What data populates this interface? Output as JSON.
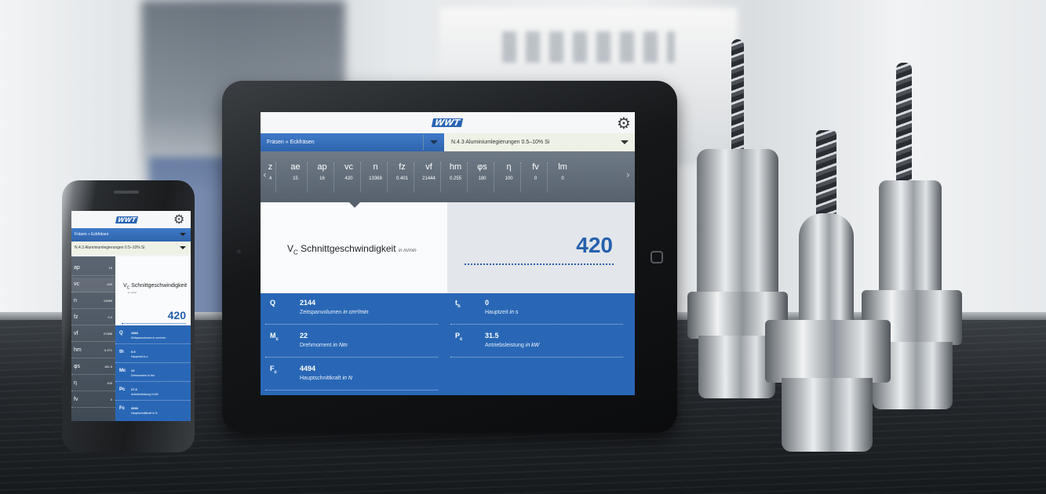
{
  "app": {
    "logo_text": "WWT",
    "settings_icon": "gear-icon",
    "accent_color": "#2967b6"
  },
  "tablet": {
    "selector_operation": "Fräsen » Eckfräsen",
    "selector_material": "N.4.3 Aluminiumlegierungen 0.5–10% Si",
    "parameters": [
      {
        "sym": "ae",
        "val": "15"
      },
      {
        "sym": "ap",
        "val": "16"
      },
      {
        "sym": "vc",
        "val": "420"
      },
      {
        "sym": "n",
        "val": "13369"
      },
      {
        "sym": "fz",
        "val": "0.401"
      },
      {
        "sym": "vf",
        "val": "21444"
      },
      {
        "sym": "hm",
        "val": "0.255"
      },
      {
        "sym": "φs",
        "val": "180"
      },
      {
        "sym": "η",
        "val": "100"
      },
      {
        "sym": "fv",
        "val": "0"
      },
      {
        "sym": "lm",
        "val": "0"
      }
    ],
    "edge_param": {
      "sym": "z",
      "val": "4"
    },
    "selected": {
      "symbol": "V",
      "subscript": "C",
      "label": "Schnittgeschwindigkeit",
      "unit": "in m/min",
      "value": "420"
    },
    "results": [
      {
        "sym": "Q",
        "sub": "",
        "value": "2144",
        "label": "Zeitspanvolumen",
        "unit": "in cm³/min"
      },
      {
        "sym": "t",
        "sub": "h",
        "value": "0",
        "label": "Hauptzeit",
        "unit": "in s"
      },
      {
        "sym": "M",
        "sub": "c",
        "value": "22",
        "label": "Drehmoment",
        "unit": "in Nm"
      },
      {
        "sym": "P",
        "sub": "c",
        "value": "31.5",
        "label": "Antriebsleistung",
        "unit": "in kW"
      },
      {
        "sym": "F",
        "sub": "c",
        "value": "4494",
        "label": "Hauptschnittkraft",
        "unit": "in N"
      }
    ]
  },
  "phone": {
    "selector_operation": "Fräsen » Eckfräsen",
    "selector_material": "N.4.3 Aluminiumlegierungen 0.5–10% Si",
    "side_params": [
      {
        "sym": "ap",
        "val": "16"
      },
      {
        "sym": "vc",
        "val": "420"
      },
      {
        "sym": "n",
        "val": "13369"
      },
      {
        "sym": "fz",
        "val": "0.4"
      },
      {
        "sym": "vf",
        "val": "21386"
      },
      {
        "sym": "hm",
        "val": "0.271"
      },
      {
        "sym": "φs",
        "val": "161.5"
      },
      {
        "sym": "η",
        "val": "100"
      },
      {
        "sym": "fv",
        "val": "0"
      }
    ],
    "selected": {
      "symbol": "V",
      "subscript": "C",
      "label": "Schnittgeschwindigkeit",
      "unit": "in m/min",
      "value": "420"
    },
    "results": [
      {
        "sym": "Q",
        "value": "1863",
        "label": "Zeitspanvolumen in cm³/min"
      },
      {
        "sym": "th",
        "value": "0.0",
        "label": "Hauptzeit in s"
      },
      {
        "sym": "Mc",
        "value": "12",
        "label": "Drehmoment in Nm"
      },
      {
        "sym": "Pc",
        "value": "27.3",
        "label": "Antriebsleistung in kW"
      },
      {
        "sym": "Fc",
        "value": "3530",
        "label": "Hauptschnittkraft in N"
      }
    ]
  }
}
